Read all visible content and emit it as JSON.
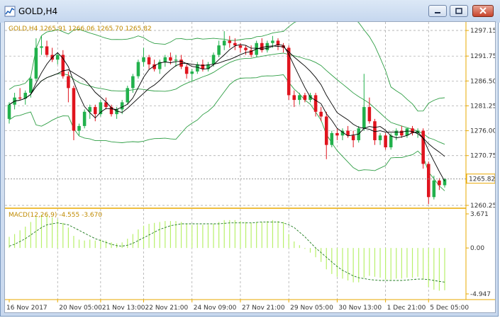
{
  "window": {
    "title": "GOLD,H4",
    "buttons": [
      "minimize",
      "maximize",
      "close"
    ]
  },
  "price_panel": {
    "label": "GOLD,H4  1265.91 1266.06 1265.70 1265.82",
    "current_price": "1265.82",
    "y_ticks": [
      "1297.15",
      "1291.75",
      "1286.50",
      "1281.25",
      "1276.00",
      "1270.75",
      "1260.25"
    ]
  },
  "macd_panel": {
    "label": "MACD(12,26,9) -4.555 -3.670",
    "y_ticks": [
      "3.671",
      "0.00",
      "-4.947"
    ]
  },
  "x_ticks": [
    "16 Nov 2017",
    "20 Nov 05:00",
    "21 Nov 13:00",
    "22 Nov 21:00",
    "24 Nov 09:00",
    "27 Nov 21:00",
    "29 Nov 05:00",
    "30 Nov 13:00",
    "1 Dec 21:00",
    "5 Dec 05:00"
  ],
  "colors": {
    "bull": "#22b14c",
    "bear": "#e0141e",
    "bands": "#2e9e44",
    "ma": "#000000",
    "axis": "#e8a800",
    "histogram": "#b8f06a",
    "signal": "#1c7a1c",
    "grid": "#a0a0a0"
  },
  "chart_data": {
    "type": "candlestick",
    "symbol": "GOLD",
    "timeframe": "H4",
    "ylim": [
      1260.25,
      1297.15
    ],
    "candles": [
      [
        1278.5,
        1282.0,
        1277.5,
        1281.5
      ],
      [
        1281.5,
        1284.0,
        1280.5,
        1283.0
      ],
      [
        1283.0,
        1285.0,
        1282.5,
        1282.8
      ],
      [
        1282.8,
        1284.5,
        1281.5,
        1284.0
      ],
      [
        1284.0,
        1287.5,
        1283.0,
        1287.0
      ],
      [
        1287.0,
        1295.5,
        1286.5,
        1293.5
      ],
      [
        1293.5,
        1296.0,
        1292.0,
        1293.8
      ],
      [
        1293.8,
        1295.0,
        1291.5,
        1292.0
      ],
      [
        1292.0,
        1293.5,
        1290.5,
        1291.0
      ],
      [
        1291.0,
        1292.5,
        1290.0,
        1292.0
      ],
      [
        1292.0,
        1293.0,
        1287.0,
        1287.5
      ],
      [
        1287.5,
        1288.5,
        1282.0,
        1285.0
      ],
      [
        1285.0,
        1285.5,
        1274.0,
        1276.0
      ],
      [
        1276.0,
        1277.5,
        1275.0,
        1277.0
      ],
      [
        1277.0,
        1280.5,
        1276.5,
        1280.0
      ],
      [
        1280.0,
        1281.5,
        1278.5,
        1281.0
      ],
      [
        1281.0,
        1281.5,
        1278.0,
        1279.5
      ],
      [
        1279.5,
        1282.5,
        1279.0,
        1282.0
      ],
      [
        1282.0,
        1283.0,
        1280.5,
        1281.0
      ],
      [
        1281.0,
        1281.5,
        1279.0,
        1279.5
      ],
      [
        1279.5,
        1281.0,
        1278.5,
        1280.5
      ],
      [
        1280.5,
        1282.5,
        1279.5,
        1282.0
      ],
      [
        1282.0,
        1285.5,
        1281.5,
        1285.0
      ],
      [
        1285.0,
        1288.0,
        1284.0,
        1287.5
      ],
      [
        1287.5,
        1291.0,
        1287.0,
        1290.5
      ],
      [
        1290.5,
        1293.5,
        1289.5,
        1291.5
      ],
      [
        1291.5,
        1292.0,
        1289.0,
        1290.0
      ],
      [
        1290.0,
        1291.0,
        1288.5,
        1289.0
      ],
      [
        1289.0,
        1291.0,
        1288.0,
        1290.5
      ],
      [
        1290.5,
        1292.0,
        1289.5,
        1291.5
      ],
      [
        1291.5,
        1292.5,
        1290.0,
        1290.8
      ],
      [
        1290.8,
        1292.0,
        1289.5,
        1291.0
      ],
      [
        1291.0,
        1292.0,
        1289.0,
        1289.5
      ],
      [
        1289.5,
        1290.0,
        1287.0,
        1288.0
      ],
      [
        1288.0,
        1289.0,
        1286.5,
        1288.5
      ],
      [
        1288.5,
        1290.5,
        1288.0,
        1290.0
      ],
      [
        1290.0,
        1291.0,
        1288.5,
        1289.0
      ],
      [
        1289.0,
        1290.5,
        1288.5,
        1290.0
      ],
      [
        1290.0,
        1292.5,
        1289.5,
        1292.0
      ],
      [
        1292.0,
        1295.0,
        1291.5,
        1294.0
      ],
      [
        1294.0,
        1297.0,
        1293.0,
        1295.0
      ],
      [
        1295.0,
        1296.0,
        1293.5,
        1294.5
      ],
      [
        1294.5,
        1295.5,
        1293.0,
        1294.0
      ],
      [
        1294.0,
        1294.5,
        1292.5,
        1293.5
      ],
      [
        1293.5,
        1294.0,
        1292.0,
        1293.0
      ],
      [
        1293.0,
        1294.0,
        1291.5,
        1292.0
      ],
      [
        1292.0,
        1295.0,
        1291.5,
        1294.5
      ],
      [
        1294.5,
        1295.5,
        1292.5,
        1293.0
      ],
      [
        1293.0,
        1295.0,
        1292.5,
        1294.5
      ],
      [
        1294.5,
        1296.0,
        1293.5,
        1295.0
      ],
      [
        1295.0,
        1295.5,
        1293.0,
        1294.0
      ],
      [
        1294.0,
        1294.5,
        1292.5,
        1293.5
      ],
      [
        1293.5,
        1294.0,
        1282.5,
        1283.5
      ],
      [
        1283.5,
        1284.5,
        1281.0,
        1282.5
      ],
      [
        1282.5,
        1284.0,
        1281.5,
        1283.5
      ],
      [
        1283.5,
        1284.0,
        1282.0,
        1282.5
      ],
      [
        1282.5,
        1284.0,
        1282.0,
        1283.5
      ],
      [
        1283.5,
        1284.0,
        1279.0,
        1280.0
      ],
      [
        1280.0,
        1281.0,
        1278.0,
        1279.0
      ],
      [
        1279.0,
        1280.0,
        1270.0,
        1273.0
      ],
      [
        1273.0,
        1276.0,
        1272.5,
        1275.5
      ],
      [
        1275.5,
        1276.5,
        1274.0,
        1275.0
      ],
      [
        1275.0,
        1276.5,
        1274.0,
        1276.0
      ],
      [
        1276.0,
        1277.0,
        1274.5,
        1275.0
      ],
      [
        1275.0,
        1276.0,
        1272.5,
        1274.0
      ],
      [
        1274.0,
        1277.0,
        1273.5,
        1276.5
      ],
      [
        1276.5,
        1288.0,
        1276.0,
        1281.0
      ],
      [
        1281.0,
        1283.0,
        1277.5,
        1278.0
      ],
      [
        1278.0,
        1278.5,
        1273.0,
        1274.0
      ],
      [
        1274.0,
        1275.5,
        1273.0,
        1275.0
      ],
      [
        1275.0,
        1275.5,
        1272.0,
        1272.5
      ],
      [
        1272.5,
        1275.5,
        1272.0,
        1275.0
      ],
      [
        1275.0,
        1276.5,
        1274.0,
        1276.0
      ],
      [
        1276.0,
        1277.0,
        1274.5,
        1275.0
      ],
      [
        1275.0,
        1276.5,
        1274.5,
        1276.5
      ],
      [
        1276.5,
        1277.0,
        1275.0,
        1275.5
      ],
      [
        1275.5,
        1276.5,
        1274.5,
        1276.0
      ],
      [
        1276.0,
        1276.5,
        1268.0,
        1269.0
      ],
      [
        1269.0,
        1269.5,
        1260.5,
        1262.0
      ],
      [
        1262.0,
        1266.5,
        1261.5,
        1265.5
      ],
      [
        1265.5,
        1266.0,
        1263.5,
        1264.5
      ],
      [
        1264.5,
        1266.0,
        1264.0,
        1265.82
      ]
    ],
    "macd_histogram": [
      1.2,
      1.5,
      1.9,
      2.3,
      2.8,
      3.4,
      3.6,
      3.5,
      3.3,
      3.1,
      2.7,
      2.2,
      1.3,
      0.9,
      0.8,
      0.9,
      0.8,
      0.9,
      0.8,
      0.6,
      0.5,
      0.6,
      1.0,
      1.5,
      2.0,
      2.4,
      2.6,
      2.7,
      2.8,
      2.9,
      2.9,
      2.9,
      2.8,
      2.6,
      2.5,
      2.5,
      2.5,
      2.5,
      2.6,
      2.8,
      3.0,
      3.0,
      3.0,
      2.9,
      2.8,
      2.7,
      2.8,
      2.8,
      2.9,
      3.0,
      2.9,
      2.8,
      1.5,
      0.7,
      0.3,
      -0.1,
      -0.5,
      -1.0,
      -1.5,
      -2.3,
      -2.8,
      -3.1,
      -3.3,
      -3.5,
      -3.7,
      -3.7,
      -3.2,
      -3.0,
      -3.1,
      -3.2,
      -3.4,
      -3.4,
      -3.3,
      -3.3,
      -3.2,
      -3.2,
      -3.1,
      -3.4,
      -4.2,
      -4.5,
      -4.6,
      -4.555
    ],
    "macd_signal": [
      0.2,
      0.4,
      0.7,
      1.0,
      1.4,
      1.8,
      2.2,
      2.5,
      2.6,
      2.7,
      2.6,
      2.5,
      2.2,
      1.9,
      1.6,
      1.3,
      1.0,
      0.8,
      0.6,
      0.4,
      0.25,
      0.2,
      0.3,
      0.5,
      0.8,
      1.1,
      1.4,
      1.7,
      2.0,
      2.2,
      2.4,
      2.5,
      2.6,
      2.6,
      2.6,
      2.6,
      2.6,
      2.6,
      2.6,
      2.6,
      2.65,
      2.7,
      2.7,
      2.7,
      2.7,
      2.7,
      2.75,
      2.8,
      2.8,
      2.8,
      2.8,
      2.7,
      2.5,
      2.2,
      1.7,
      1.2,
      0.6,
      0.0,
      -0.5,
      -1.0,
      -1.5,
      -2.0,
      -2.4,
      -2.7,
      -3.0,
      -3.2,
      -3.3,
      -3.4,
      -3.45,
      -3.5,
      -3.5,
      -3.5,
      -3.5,
      -3.5,
      -3.45,
      -3.4,
      -3.35,
      -3.35,
      -3.4,
      -3.5,
      -3.6,
      -3.67
    ],
    "macd_ylim": [
      -4.947,
      3.671
    ]
  }
}
